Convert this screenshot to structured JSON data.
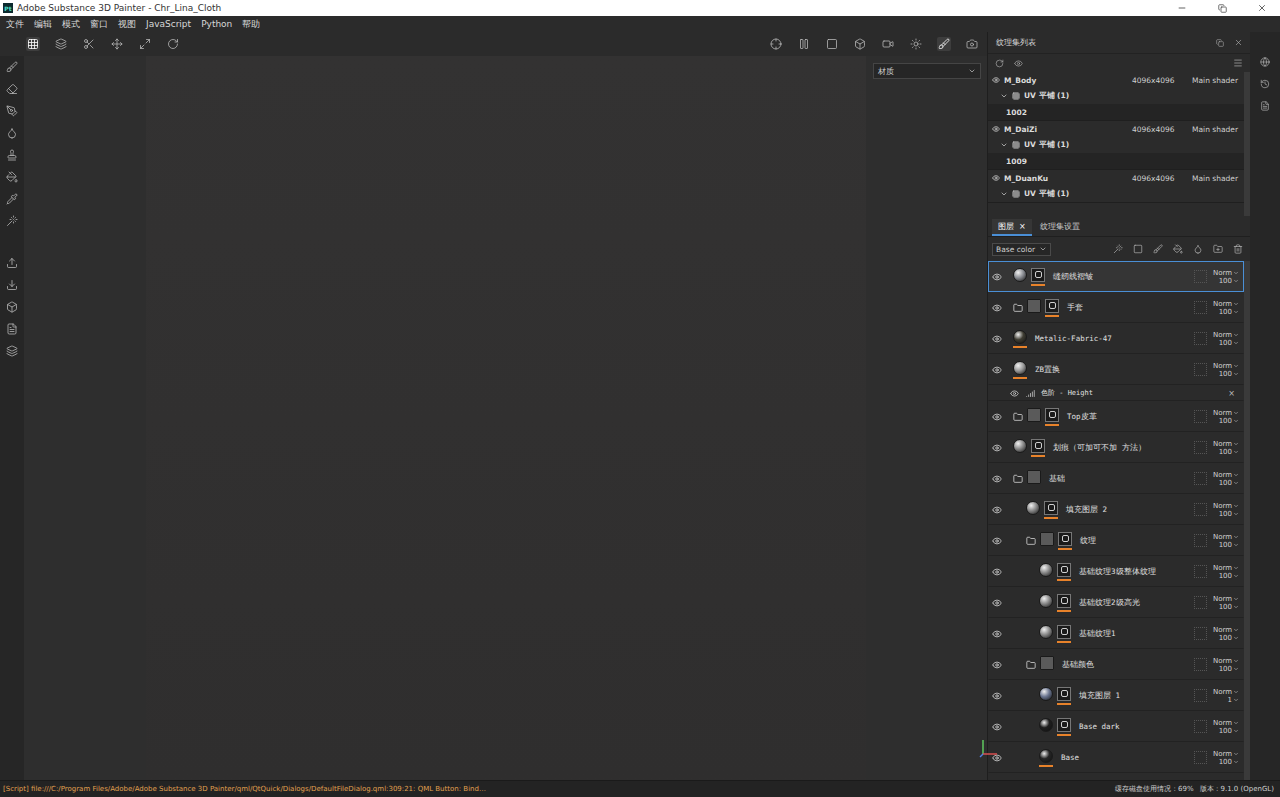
{
  "window": {
    "title": "Adobe Substance 3D Painter - Chr_Lina_Cloth",
    "logo": "Pt"
  },
  "menu": [
    "文件",
    "编辑",
    "模式",
    "窗口",
    "视图",
    "JavaScript",
    "Python",
    "帮助"
  ],
  "viewport": {
    "mode_select": "材质"
  },
  "texture_sets": {
    "title": "纹理集列表",
    "items": [
      {
        "name": "M_Body",
        "resolution": "4096x4096",
        "shader": "Main shader",
        "uv": "UV 平铺 (1)",
        "tile": "1002"
      },
      {
        "name": "M_DaiZi",
        "resolution": "4096x4096",
        "shader": "Main shader",
        "uv": "UV 平铺 (1)",
        "tile": "1009"
      },
      {
        "name": "M_DuanKu",
        "resolution": "4096x4096",
        "shader": "Main shader",
        "uv": "UV 平铺 (1)",
        "tile": ""
      }
    ]
  },
  "tabs": [
    {
      "label": "图层",
      "selected": true,
      "close": "×"
    },
    {
      "label": "纹理集设置",
      "selected": false,
      "close": ""
    }
  ],
  "channel_select": "Base color",
  "layers": [
    {
      "name": "缝纫线褶皱",
      "kind": "layer",
      "indent": 0,
      "mask": true,
      "thumb": "#8a8d93",
      "blend": "Norm",
      "opacity": "100",
      "selected": true
    },
    {
      "name": "手套",
      "kind": "folder",
      "indent": 0,
      "mask": true,
      "thumb": "#5a5a5a",
      "blend": "Norm",
      "opacity": "100",
      "selected": false
    },
    {
      "name": "Metalic-Fabric-47",
      "kind": "layer",
      "indent": 0,
      "mask": false,
      "thumb": "#3f3d33",
      "blend": "Norm",
      "opacity": "100",
      "selected": false
    },
    {
      "name": "ZB置换",
      "kind": "layer",
      "indent": 0,
      "mask": false,
      "thumb": "#9a9a9a",
      "blend": "Norm",
      "opacity": "100",
      "selected": false
    },
    {
      "name": "色阶 - Height",
      "kind": "effect",
      "indent": 1,
      "mask": false,
      "thumb": "",
      "blend": "",
      "opacity": "",
      "selected": false,
      "close": "×"
    },
    {
      "name": "Top皮革",
      "kind": "folder",
      "indent": 0,
      "mask": true,
      "thumb": "#5a5a5a",
      "blend": "Norm",
      "opacity": "100",
      "selected": false
    },
    {
      "name": "划痕（可加可不加 方法）",
      "kind": "layer",
      "indent": 0,
      "mask": true,
      "thumb": "#8a8a8a",
      "blend": "Norm",
      "opacity": "100",
      "selected": false
    },
    {
      "name": "基础",
      "kind": "folder",
      "indent": 0,
      "mask": false,
      "thumb": "#5a5a5a",
      "blend": "Norm",
      "opacity": "100",
      "selected": false
    },
    {
      "name": "填充图层 2",
      "kind": "layer",
      "indent": 1,
      "mask": true,
      "thumb": "#8a8a8a",
      "blend": "Norm",
      "opacity": "100",
      "selected": false
    },
    {
      "name": "纹理",
      "kind": "folder",
      "indent": 1,
      "mask": true,
      "thumb": "#5a5a5a",
      "blend": "Norm",
      "opacity": "100",
      "selected": false
    },
    {
      "name": "基础纹理3级整体纹理",
      "kind": "layer",
      "indent": 2,
      "mask": true,
      "thumb": "#8a8a8a",
      "blend": "Norm",
      "opacity": "100",
      "selected": false
    },
    {
      "name": "基础纹理2级高光",
      "kind": "layer",
      "indent": 2,
      "mask": true,
      "thumb": "#8a8a8a",
      "blend": "Norm",
      "opacity": "100",
      "selected": false
    },
    {
      "name": "基础纹理1",
      "kind": "layer",
      "indent": 2,
      "mask": true,
      "thumb": "#8a8a8a",
      "blend": "Norm",
      "opacity": "100",
      "selected": false
    },
    {
      "name": "基础颜色",
      "kind": "folder",
      "indent": 1,
      "mask": false,
      "thumb": "#5a5a5a",
      "blend": "Norm",
      "opacity": "100",
      "selected": false
    },
    {
      "name": "填充图层 1",
      "kind": "layer",
      "indent": 2,
      "mask": true,
      "thumb": "#6a7590",
      "blend": "Norm",
      "opacity": "1",
      "selected": false
    },
    {
      "name": "Base dark",
      "kind": "layer",
      "indent": 2,
      "mask": true,
      "thumb": "#1e1e1e",
      "blend": "Norm",
      "opacity": "100",
      "selected": false
    },
    {
      "name": "Base",
      "kind": "layer",
      "indent": 2,
      "mask": false,
      "thumb": "#262626",
      "blend": "Norm",
      "opacity": "100",
      "selected": false
    }
  ],
  "status_bar": {
    "message": "[Script] file:///C:/Program Files/Adobe/Adobe Substance 3D Painter/qml/QtQuick/Dialogs/DefaultFileDialog.qml:309:21: QML Button: Bind…",
    "cache_label": "缓存磁盘使用情况 :",
    "cache_value": "69%",
    "version": "版本 : 9.1.0 (OpenGL)"
  }
}
